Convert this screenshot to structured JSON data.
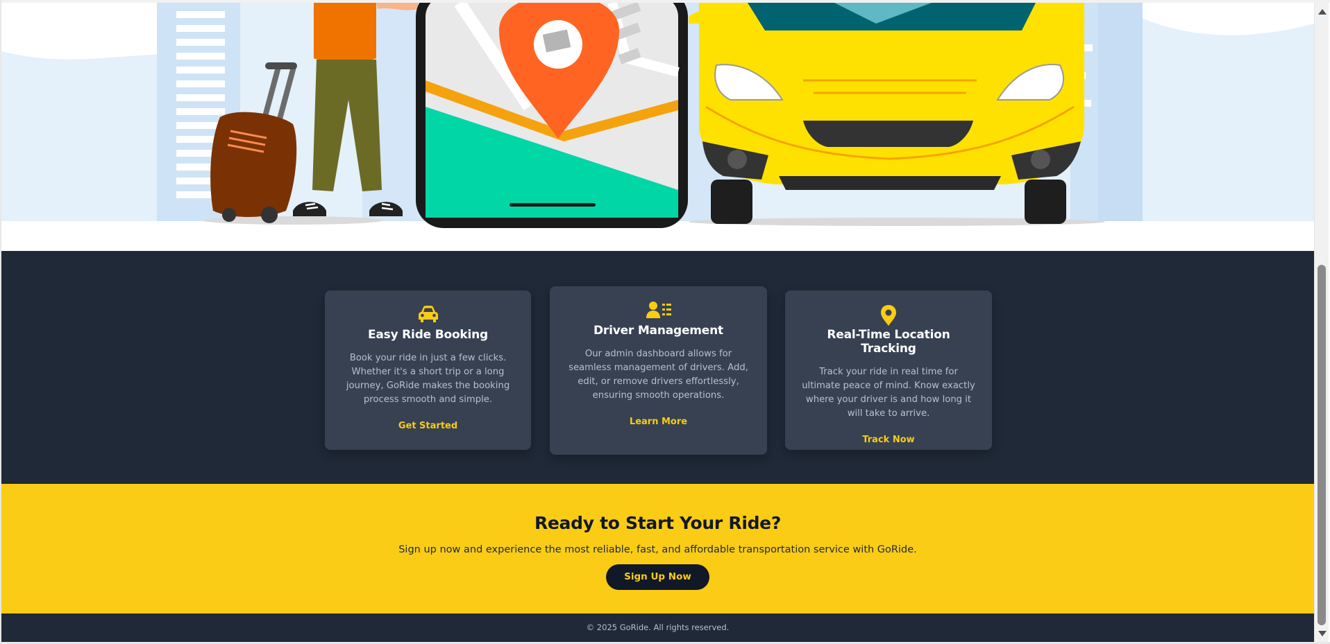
{
  "features": [
    {
      "icon": "car-icon",
      "title": "Easy Ride Booking",
      "description": "Book your ride in just a few clicks. Whether it's a short trip or a long journey, GoRide makes the booking process smooth and simple.",
      "link": "Get Started"
    },
    {
      "icon": "driver-card-icon",
      "title": "Driver Management",
      "description": "Our admin dashboard allows for seamless management of drivers. Add, edit, or remove drivers effortlessly, ensuring smooth operations.",
      "link": "Learn More"
    },
    {
      "icon": "map-pin-icon",
      "title": "Real-Time Location Tracking",
      "description": "Track your ride in real time for ultimate peace of mind. Know exactly where your driver is and how long it will take to arrive.",
      "link": "Track Now"
    }
  ],
  "cta": {
    "heading": "Ready to Start Your Ride?",
    "text": "Sign up now and experience the most reliable, fast, and affordable transportation service with GoRide.",
    "button": "Sign Up Now"
  },
  "footer": {
    "copyright": "© 2025 GoRide. All rights reserved."
  },
  "colors": {
    "dark": "#1f2937",
    "card": "#374151",
    "accent": "#facc15",
    "pin": "#ff6422",
    "taxi": "#ffe100"
  }
}
